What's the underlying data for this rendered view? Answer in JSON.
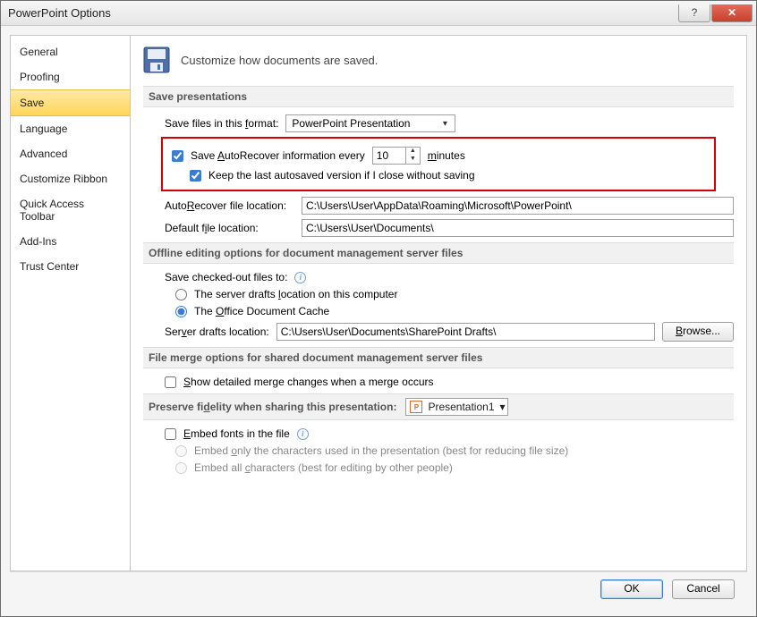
{
  "window": {
    "title": "PowerPoint Options"
  },
  "sidebar": {
    "items": [
      {
        "label": "General"
      },
      {
        "label": "Proofing"
      },
      {
        "label": "Save"
      },
      {
        "label": "Language"
      },
      {
        "label": "Advanced"
      },
      {
        "label": "Customize Ribbon"
      },
      {
        "label": "Quick Access Toolbar"
      },
      {
        "label": "Add-Ins"
      },
      {
        "label": "Trust Center"
      }
    ],
    "selected": 2
  },
  "page": {
    "heading": "Customize how documents are saved."
  },
  "save_presentations": {
    "header": "Save presentations",
    "format_label": "Save files in this format:",
    "format_value": "PowerPoint Presentation",
    "autorecover_label": "Save AutoRecover information every",
    "autorecover_value": "10",
    "autorecover_unit": "minutes",
    "autorecover_checked": true,
    "keep_last_label": "Keep the last autosaved version if I close without saving",
    "keep_last_checked": true,
    "autorecover_loc_label": "AutoRecover file location:",
    "autorecover_loc_value": "C:\\Users\\User\\AppData\\Roaming\\Microsoft\\PowerPoint\\",
    "default_loc_label": "Default file location:",
    "default_loc_value": "C:\\Users\\User\\Documents\\"
  },
  "offline": {
    "header": "Offline editing options for document management server files",
    "save_checked_label": "Save checked-out files to:",
    "opt_server_label": "The server drafts location on this computer",
    "opt_cache_label": "The Office Document Cache",
    "selected": "cache",
    "drafts_label": "Server drafts location:",
    "drafts_value": "C:\\Users\\User\\Documents\\SharePoint Drafts\\",
    "browse_label": "Browse..."
  },
  "merge": {
    "header": "File merge options for shared document management server files",
    "show_detail_label": "Show detailed merge changes when a merge occurs",
    "show_detail_checked": false
  },
  "preserve": {
    "header": "Preserve fidelity when sharing this presentation:",
    "presentation_name": "Presentation1",
    "embed_label": "Embed fonts in the file",
    "embed_checked": false,
    "embed_only_label": "Embed only the characters used in the presentation (best for reducing file size)",
    "embed_all_label": "Embed all characters (best for editing by other people)"
  },
  "footer": {
    "ok": "OK",
    "cancel": "Cancel"
  }
}
